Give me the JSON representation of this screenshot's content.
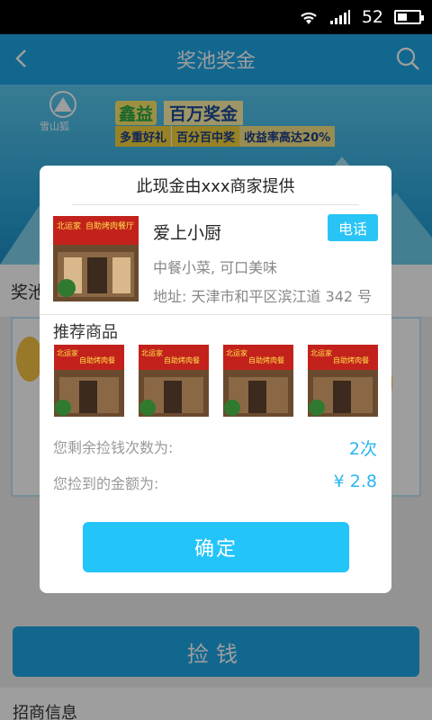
{
  "status_bar": {
    "battery_text": "52",
    "icons": [
      "wifi-icon",
      "signal-icon",
      "battery-icon"
    ]
  },
  "nav": {
    "title": "奖池奖金",
    "icons": [
      "back-arrow-icon",
      "search-icon"
    ]
  },
  "banner": {
    "logo_text": "雪山狐",
    "headline_a": "鑫益",
    "headline_b": "百万奖金",
    "tag1": "多重好礼",
    "tag2": "百分百中奖",
    "tag3": "收益率高达20%"
  },
  "content": {
    "section_label": "奖池",
    "pick_button": "捡钱",
    "bottom_label": "招商信息"
  },
  "modal": {
    "title": "此现金由xxx商家提供",
    "merchant": {
      "name": "爱上小厨",
      "call_label": "电话",
      "description": "中餐小菜, 可口美味",
      "address": "地址: 天津市和平区滨江道 342 号",
      "photo_sign": "北运家 自助烤肉餐厅"
    },
    "recommend_title": "推荐商品",
    "recommend_items": [
      {
        "sign": "北运家 自助烤肉餐"
      },
      {
        "sign": "北运家 自助烤肉餐"
      },
      {
        "sign": "北运家 自助烤肉餐"
      },
      {
        "sign": "北运家 自助烤肉餐"
      }
    ],
    "remaining_label": "您剩余捡钱次数为:",
    "remaining_value": "2次",
    "amount_label": "您捡到的金额为:",
    "amount_value": "¥ 2.8",
    "confirm_label": "确定"
  },
  "colors": {
    "accent": "#1ea7e6",
    "button": "#23c4fa",
    "value_text": "#29b6f0"
  }
}
